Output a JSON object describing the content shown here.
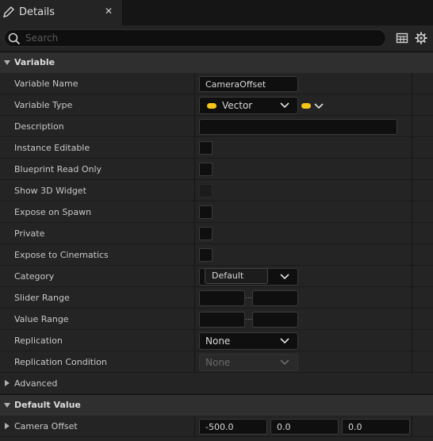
{
  "tab": {
    "title": "Details",
    "close": "✕"
  },
  "search": {
    "placeholder": "Search",
    "value": ""
  },
  "sections": {
    "variable": "Variable",
    "default_value": "Default Value"
  },
  "rows": {
    "variable_name": {
      "label": "Variable Name",
      "value": "CameraOffset"
    },
    "variable_type": {
      "label": "Variable Type",
      "value": "Vector"
    },
    "description": {
      "label": "Description",
      "value": ""
    },
    "instance_editable": {
      "label": "Instance Editable"
    },
    "blueprint_read_only": {
      "label": "Blueprint Read Only"
    },
    "show_3d_widget": {
      "label": "Show 3D Widget"
    },
    "expose_on_spawn": {
      "label": "Expose on Spawn"
    },
    "private": {
      "label": "Private"
    },
    "expose_to_cinematics": {
      "label": "Expose to Cinematics"
    },
    "category": {
      "label": "Category",
      "value": "Default"
    },
    "slider_range": {
      "label": "Slider Range",
      "min": "",
      "max": "",
      "sep": "..."
    },
    "value_range": {
      "label": "Value Range",
      "min": "",
      "max": "",
      "sep": "..."
    },
    "replication": {
      "label": "Replication",
      "value": "None"
    },
    "replication_condition": {
      "label": "Replication Condition",
      "value": "None"
    },
    "advanced": {
      "label": "Advanced"
    },
    "camera_offset": {
      "label": "Camera Offset",
      "x": "-500.0",
      "y": "0.0",
      "z": "0.0"
    }
  },
  "colors": {
    "pin_vector": "#f5c518",
    "panel": "#242424",
    "header": "#2f2f2f"
  },
  "icons": [
    "pencil-icon",
    "close-icon",
    "search-icon",
    "table-view-icon",
    "settings-gear-icon",
    "collapse-arrow-icon",
    "expand-arrow-icon",
    "chevron-down-icon"
  ]
}
